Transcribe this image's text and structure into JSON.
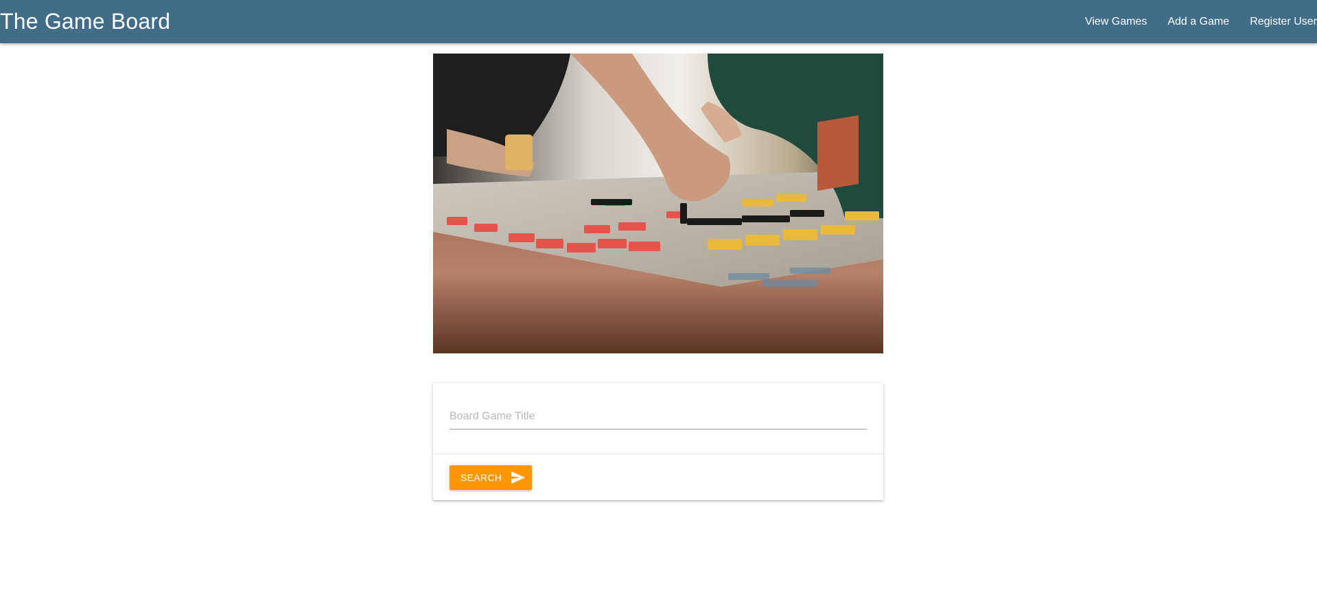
{
  "header": {
    "brand": "The Game Board",
    "nav": [
      {
        "label": "View Games"
      },
      {
        "label": "Add a Game"
      },
      {
        "label": "Register User"
      }
    ]
  },
  "hero": {
    "alt": "People playing a board game on the floor"
  },
  "search": {
    "placeholder": "Board Game Title",
    "value": "",
    "button_label": "Search",
    "button_icon": "send-icon"
  },
  "colors": {
    "navbar": "#416d88",
    "accent": "#ff9800"
  }
}
